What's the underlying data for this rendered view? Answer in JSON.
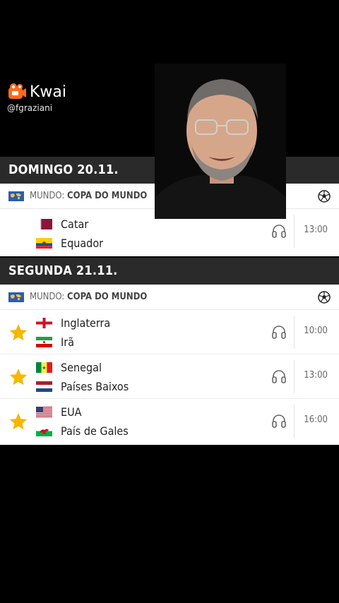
{
  "watermark": {
    "brand": "Kwai",
    "handle": "@fgraziani"
  },
  "days": [
    {
      "header": "DOMINGO 20.11.",
      "league_prefix": "MUNDO:",
      "league_name": "COPA DO MUNDO",
      "matches": [
        {
          "home": "Catar",
          "away": "Equador",
          "time": "13:00",
          "favorite": false
        }
      ]
    },
    {
      "header": "SEGUNDA 21.11.",
      "league_prefix": "MUNDO:",
      "league_name": "COPA DO MUNDO",
      "matches": [
        {
          "home": "Inglaterra",
          "away": "Irã",
          "time": "10:00",
          "favorite": true
        },
        {
          "home": "Senegal",
          "away": "Países Baixos",
          "time": "13:00",
          "favorite": true
        },
        {
          "home": "EUA",
          "away": "País de Gales",
          "time": "16:00",
          "favorite": true
        }
      ]
    }
  ],
  "colors": {
    "star": "#f5b800",
    "header_bg": "#2a2a2a",
    "brand_orange": "#ff6a1a"
  },
  "icons": {
    "favorite": "star-icon",
    "audio": "headset-icon",
    "sport": "soccer-ball-icon",
    "league": "world-map-flag-icon"
  }
}
